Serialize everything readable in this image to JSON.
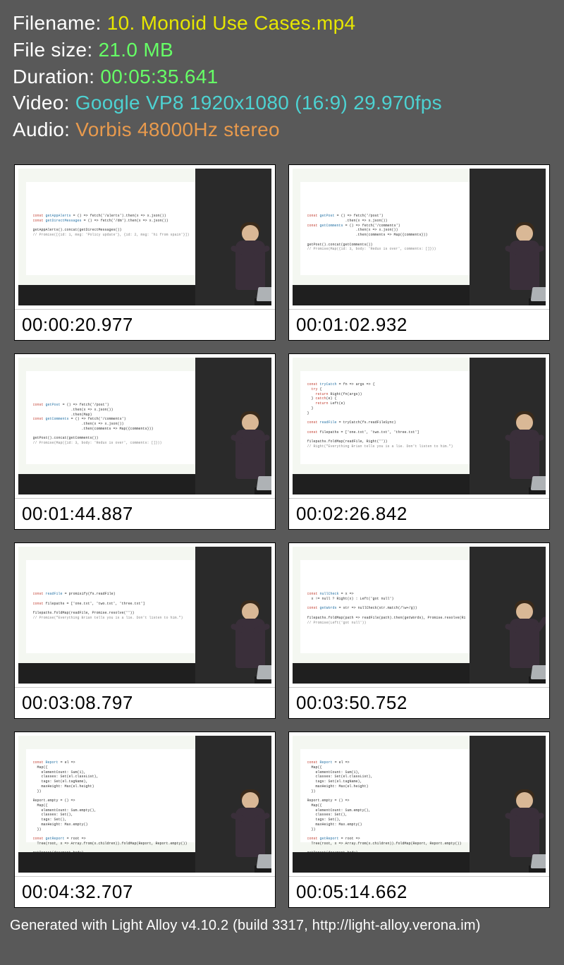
{
  "info": {
    "filename_label": "Filename: ",
    "filename_value": "10. Monoid Use Cases.mp4",
    "filesize_label": "File size: ",
    "filesize_value": "21.0 MB",
    "duration_label": "Duration: ",
    "duration_value": "00:05:35.641",
    "video_label": "Video: ",
    "video_value": "Google VP8 1920x1080 (16:9) 29.970fps",
    "audio_label": "Audio: ",
    "audio_value": "Vorbis 48000Hz stereo"
  },
  "thumbnails": [
    {
      "timestamp": "00:00:20.977"
    },
    {
      "timestamp": "00:01:02.932"
    },
    {
      "timestamp": "00:01:44.887"
    },
    {
      "timestamp": "00:02:26.842"
    },
    {
      "timestamp": "00:03:08.797"
    },
    {
      "timestamp": "00:03:50.752"
    },
    {
      "timestamp": "00:04:32.707"
    },
    {
      "timestamp": "00:05:14.662"
    }
  ],
  "footer": "Generated with Light Alloy v4.10.2 (build 3317, http://light-alloy.verona.im)"
}
